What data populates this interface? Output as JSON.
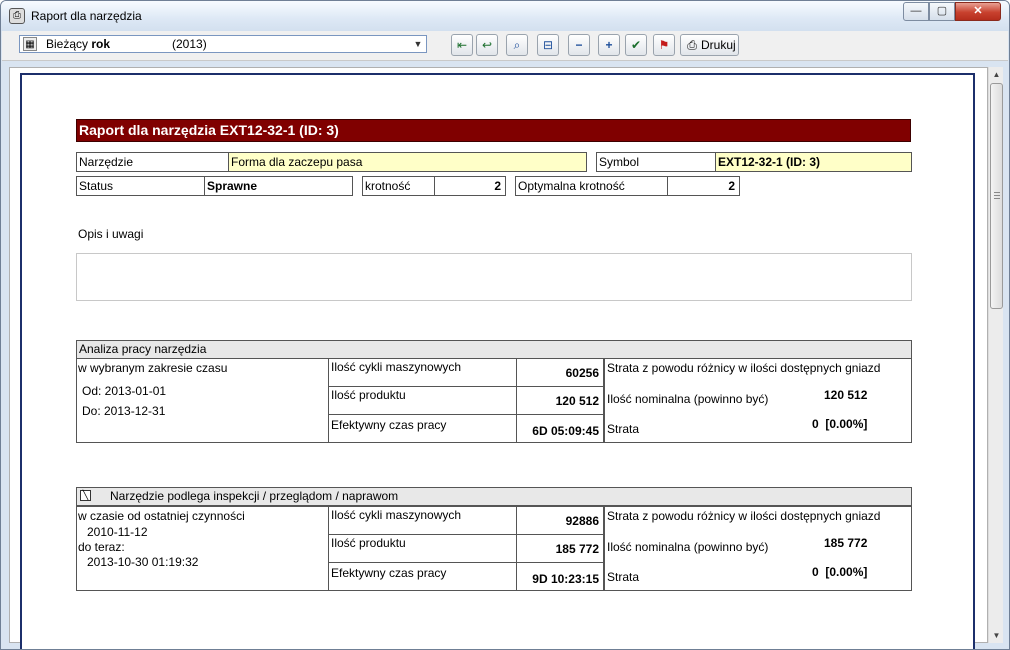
{
  "window": {
    "title": "Raport dla narzędzia",
    "app_icon": "printer-app-icon",
    "controls": {
      "minimize": "—",
      "maximize": "▢",
      "close": "✕"
    }
  },
  "toolbar": {
    "period_label_prefix": "Bieżący",
    "period_label_bold": "rok",
    "period_year": "(2013)",
    "buttons": [
      {
        "name": "first-page-icon",
        "glyph": "⇤"
      },
      {
        "name": "prev-page-icon",
        "glyph": "↩"
      },
      {
        "name": "zoom-page-icon",
        "glyph": "⌕"
      },
      {
        "name": "zoom-width-icon",
        "glyph": "⊟"
      },
      {
        "name": "zoom-out-icon",
        "glyph": "−"
      },
      {
        "name": "zoom-in-icon",
        "glyph": "+"
      },
      {
        "name": "select-check-icon",
        "glyph": "✔"
      },
      {
        "name": "pdf-export-icon",
        "glyph": "⚑"
      }
    ],
    "print_label": "Drukuj",
    "print_icon": "printer-icon"
  },
  "report": {
    "title": "Raport dla narzędzia EXT12-32-1 (ID: 3)",
    "tool_label": "Narzędzie",
    "tool_value": "Forma dla zaczepu pasa",
    "symbol_label": "Symbol",
    "symbol_value": "EXT12-32-1 (ID: 3)",
    "status_label": "Status",
    "status_value": "Sprawne",
    "multiplicity_label": "krotność",
    "multiplicity_value": "2",
    "optimal_label": "Optymalna krotność",
    "optimal_value": "2",
    "notes_label": "Opis i uwagi",
    "analysis": {
      "header": "Analiza pracy narzędzia",
      "range_label": "w wybranym zakresie czasu",
      "from": "Od: 2013-01-01",
      "to": "Do: 2013-12-31",
      "cycles_label": "Ilość cykli maszynowych",
      "cycles_value": "60256",
      "product_label": "Ilość produktu",
      "product_value": "120 512",
      "time_label": "Efektywny czas pracy",
      "time_value": "6D 05:09:45",
      "loss_header": "Strata z powodu różnicy w ilości dostępnych gniazd",
      "nominal_label": "Ilość nominalna (powinno być)",
      "nominal_value": "120 512",
      "loss_label": "Strata",
      "loss_value": "0  [0.00%]"
    },
    "inspection": {
      "header": "Narzędzie podlega inspekcji / przeglądom / naprawom",
      "since_label": "w czasie od ostatniej czynności",
      "since_date": "2010-11-12",
      "until_label": "do teraz:",
      "until_date": "2013-10-30 01:19:32",
      "cycles_label": "Ilość cykli maszynowych",
      "cycles_value": "92886",
      "product_label": "Ilość produktu",
      "product_value": "185 772",
      "time_label": "Efektywny czas pracy",
      "time_value": "9D 10:23:15",
      "loss_header": "Strata z powodu różnicy w ilości dostępnych gniazd",
      "nominal_label": "Ilość nominalna (powinno być)",
      "nominal_value": "185 772",
      "loss_label": "Strata",
      "loss_value": "0  [0.00%]"
    }
  }
}
